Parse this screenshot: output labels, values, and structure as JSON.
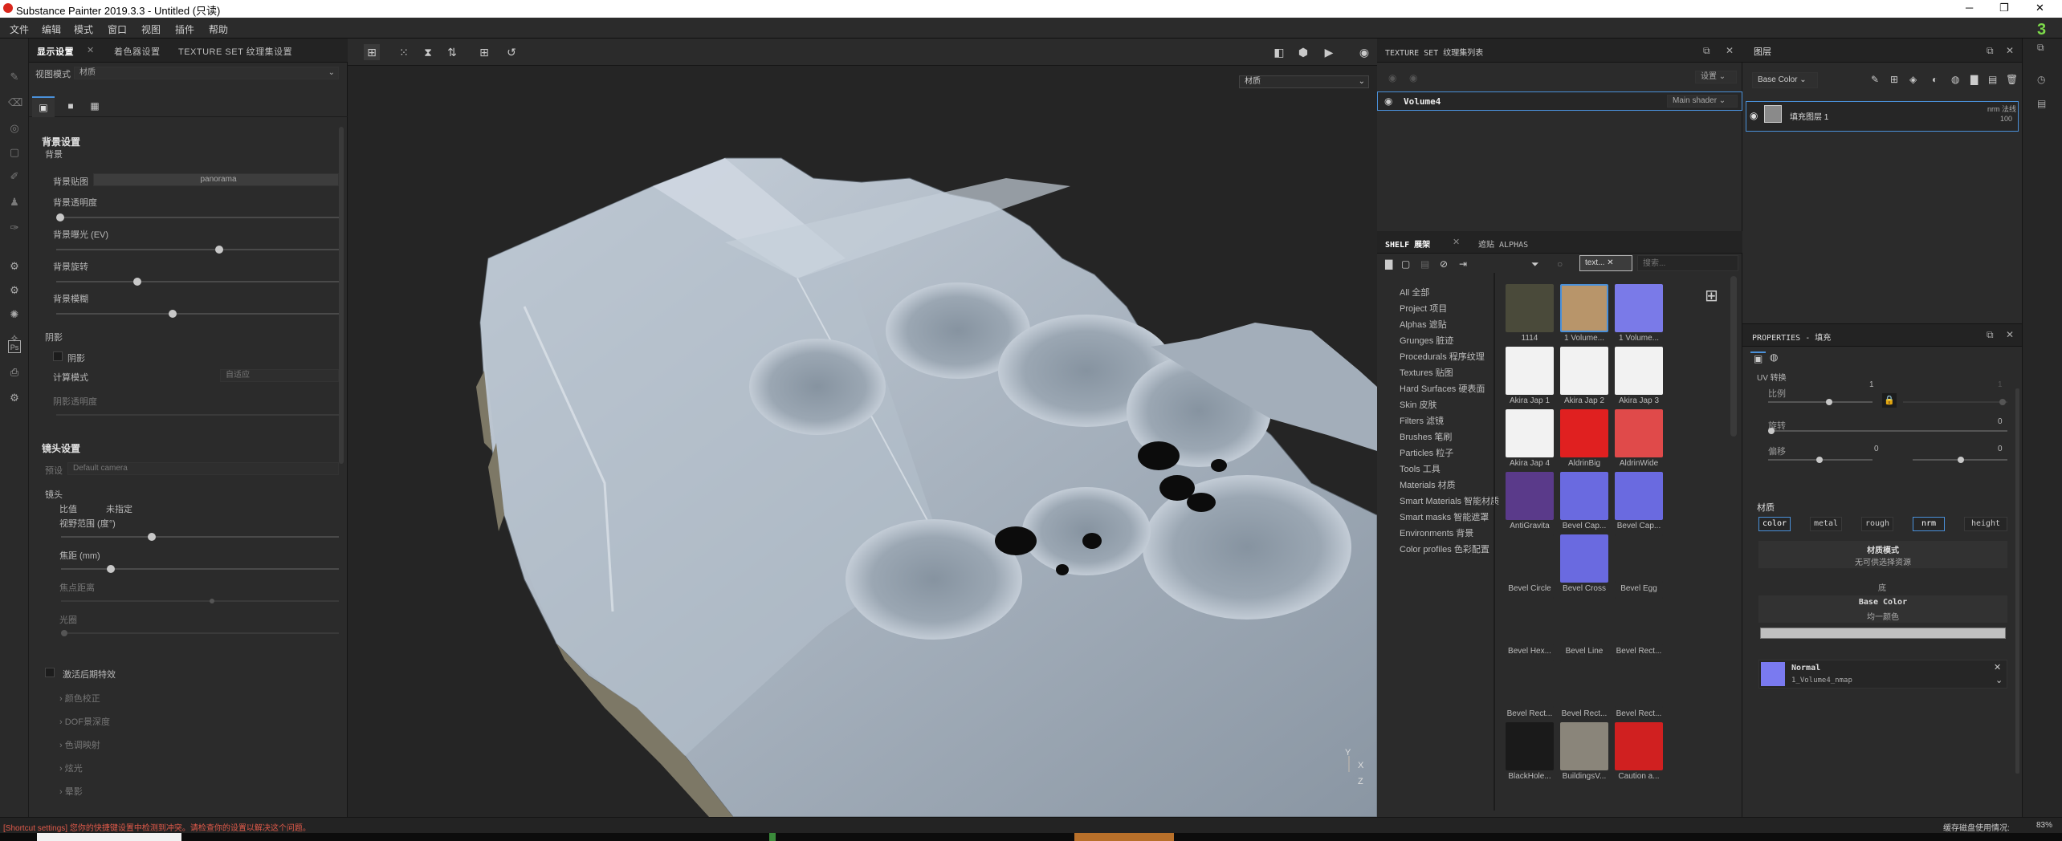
{
  "window": {
    "title": "Substance Painter 2019.3.3 - Untitled (只读)"
  },
  "menu": [
    "文件",
    "编辑",
    "模式",
    "窗口",
    "视图",
    "插件",
    "帮助"
  ],
  "left_panel": {
    "tabs": [
      "显示设置",
      "着色器设置",
      "TEXTURE SET 纹理集设置"
    ],
    "view_mode_label": "视图模式",
    "view_mode_value": "材质",
    "background_section": "背景设置",
    "background_sub": "背景",
    "bg_map_label": "背景贴图",
    "bg_map_value": "panorama",
    "bg_opacity": "背景透明度",
    "bg_exposure": "背景曝光 (EV)",
    "bg_rotation": "背景旋转",
    "bg_blur": "背景模糊",
    "bg_opacity_value": 0.0,
    "bg_exposure_value": 0.58,
    "bg_rotation_value": 0.28,
    "bg_blur_value": 0.41,
    "shadow_section": "阴影",
    "shadow_check": "阴影",
    "calc_mode": "计算模式",
    "calc_mode_value": "自适应",
    "shadow_opacity": "阴影透明度",
    "camera_section": "镜头设置",
    "preset_label": "预设",
    "preset_value": "Default camera",
    "lens_sub": "镜头",
    "ratio_label": "比值",
    "ratio_value": "未指定",
    "fov_label": "视野范围 (度°)",
    "focal_label": "焦距 (mm)",
    "focus_dist": "焦点距离",
    "aperture": "光圈",
    "fov_value": 0.32,
    "focal_value": 0.17,
    "focus_dist_value": 0.55,
    "aperture_value": 0.0,
    "post_fx": "激活后期特效",
    "post_items": [
      "颜色校正",
      "DOF景深度",
      "色调映射",
      "炫光",
      "晕影"
    ]
  },
  "viewport": {
    "material_dropdown": "材质",
    "axis": [
      "Y",
      "X",
      "Z"
    ]
  },
  "texture_set": {
    "title": "TEXTURE SET 纹理集列表",
    "settings": "设置",
    "item": "Volume4",
    "shader": "Main shader"
  },
  "shelf": {
    "tabs": [
      "SHELF 展架",
      "遮贴 ALPHAS"
    ],
    "filter_tag": "text...",
    "search_placeholder": "搜索...",
    "categories": [
      "All 全部",
      "Project 项目",
      "Alphas 遮贴",
      "Grunges 脏迹",
      "Procedurals 程序纹理",
      "Textures 贴图",
      "Hard Surfaces 硬表面",
      "Skin 皮肤",
      "Filters 滤镜",
      "Brushes 笔刷",
      "Particles 粒子",
      "Tools 工具",
      "Materials 材质",
      "Smart Materials 智能材质",
      "Smart masks 智能遮罩",
      "Environments 背景",
      "Color profiles 色彩配置"
    ],
    "items": [
      "1114",
      "1 Volume...",
      "1 Volume...",
      "Akira Jap 1",
      "Akira Jap 2",
      "Akira Jap 3",
      "Akira Jap 4",
      "AldrinBig",
      "AldrinWide",
      "AntiGravita",
      "Bevel Cap...",
      "Bevel Cap...",
      "Bevel Circle",
      "Bevel Cross",
      "Bevel Egg",
      "Bevel Hex...",
      "Bevel Line",
      "Bevel Rect...",
      "Bevel Rect...",
      "Bevel Rect...",
      "Bevel Rect...",
      "BlackHole...",
      "BuildingsV...",
      "Caution a..."
    ]
  },
  "layers": {
    "title": "图层",
    "channel": "Base Color",
    "layer_name": "填充图层 1",
    "blend": "nrm 法线",
    "opacity": "100"
  },
  "properties": {
    "title": "PROPERTIES - 填充",
    "uv_section": "UV 转换",
    "scale_label": "比例",
    "scale_value": "1",
    "scale_value2": "1",
    "rotation_label": "旋转",
    "rotation_value": "0",
    "offset_label": "偏移",
    "offset_value": "0",
    "offset_value2": "0",
    "material_label": "材质",
    "channels": [
      "color",
      "metal",
      "rough",
      "nrm",
      "height"
    ],
    "material_mode": "材质模式",
    "material_mode_value": "无可供选择资源",
    "base_color_header": "底",
    "base_color": "Base Color",
    "base_color_value": "均一颜色",
    "normal_label": "Normal",
    "normal_value": "1_Volume4_nmap"
  },
  "status": {
    "left": "[Shortcut settings] 您你的快捷键设置中检测到冲突。请检查你的设置以解决这个问题。",
    "right": "缓存磁盘使用情况:",
    "right_val": "83%"
  }
}
